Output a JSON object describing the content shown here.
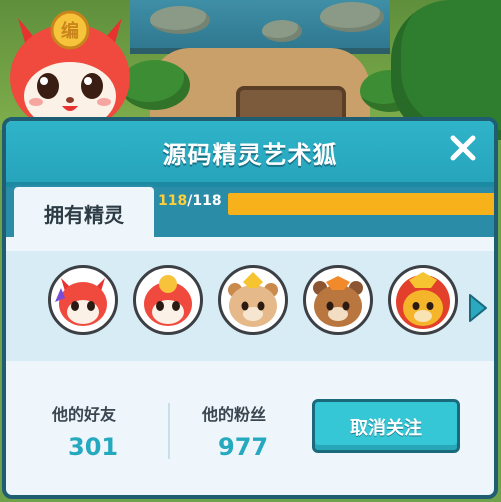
{
  "dialog": {
    "title": "源码精灵艺术狐",
    "tab_label": "拥有精灵",
    "owned_count": "118",
    "owned_total": "/118",
    "progress": 1.0
  },
  "spirits": [
    {
      "icon": "red-fox-spirit-icon"
    },
    {
      "icon": "red-fox-spirit-helmet-icon"
    },
    {
      "icon": "bear-spirit-yellow-hair-icon"
    },
    {
      "icon": "bear-spirit-dark-icon"
    },
    {
      "icon": "lion-spirit-icon"
    }
  ],
  "stats": {
    "friends_label": "他的好友",
    "friends_value": "301",
    "fans_label": "他的粉丝",
    "fans_value": "977",
    "unfollow_label": "取消关注"
  },
  "colors": {
    "header": "#2fb4c9",
    "progress_fill": "#f7b21b",
    "accent_number": "#25a9bf"
  }
}
